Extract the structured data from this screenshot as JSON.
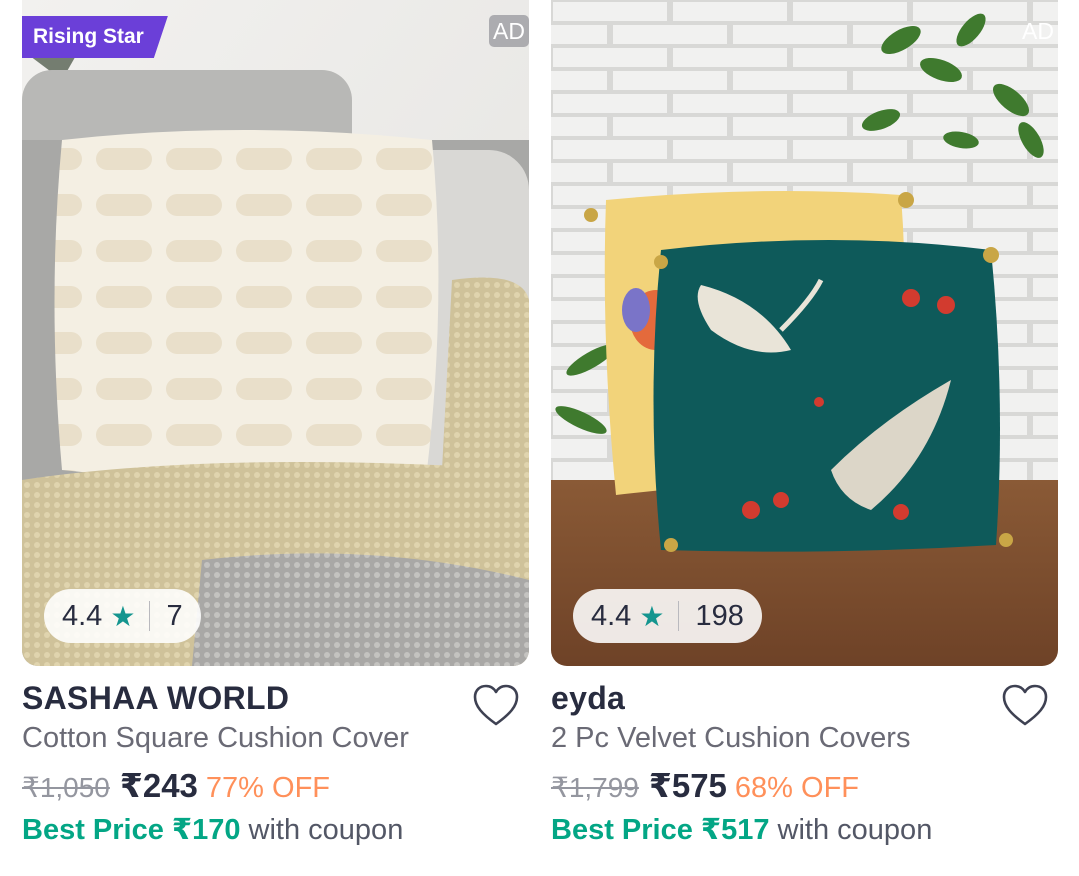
{
  "products": [
    {
      "badge": "Rising Star",
      "ad_label": "AD",
      "rating": "4.4",
      "rating_count": "7",
      "brand": "SASHAA WORLD",
      "title": "Cotton Square Cushion Cover",
      "mrp": "₹1,050",
      "price": "₹243",
      "discount": "77% OFF",
      "best_price_label": "Best Price ₹170",
      "best_price_suffix": "with coupon"
    },
    {
      "ad_label": "AD",
      "rating": "4.4",
      "rating_count": "198",
      "brand": "eyda",
      "title": "2 Pc Velvet Cushion Covers",
      "mrp": "₹1,799",
      "price": "₹575",
      "discount": "68% OFF",
      "best_price_label": "Best Price ₹517",
      "best_price_suffix": "with coupon"
    }
  ],
  "icons": {
    "star": "star-icon",
    "wishlist": "heart-icon"
  },
  "colors": {
    "rising_star_badge": "#6b3fd8",
    "discount": "#ff905a",
    "best_price": "#03a685",
    "rating_star": "#14958f"
  }
}
